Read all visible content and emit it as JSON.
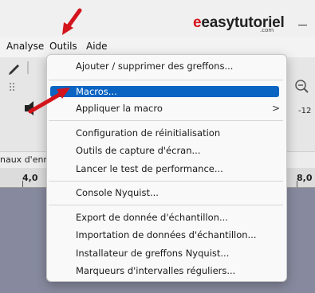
{
  "watermark": {
    "logo": "easytutoriel",
    "sub": ".com"
  },
  "menubar": {
    "items": [
      "Analyse",
      "Outils",
      "Aide"
    ]
  },
  "toolbar": {
    "meter_label": "-12"
  },
  "track": {
    "label": "naux d'enr"
  },
  "ruler": {
    "labels": [
      "4,0",
      "8,0"
    ]
  },
  "menu": {
    "items": [
      "Ajouter / supprimer des greffons...",
      "Macros...",
      "Appliquer la macro",
      "Configuration de réinitialisation",
      "Outils de capture d'écran...",
      "Lancer le test de performance...",
      "Console Nyquist...",
      "Export de donnée d'échantillon...",
      "Importation de données d'échantillon...",
      "Installateur de greffons Nyquist...",
      "Marqueurs d'intervalles réguliers..."
    ],
    "submenu_indicator": ">"
  },
  "colors": {
    "highlight": "#0c64c2",
    "annotation_arrow": "#d4141c",
    "canvas": "#878a9e"
  }
}
